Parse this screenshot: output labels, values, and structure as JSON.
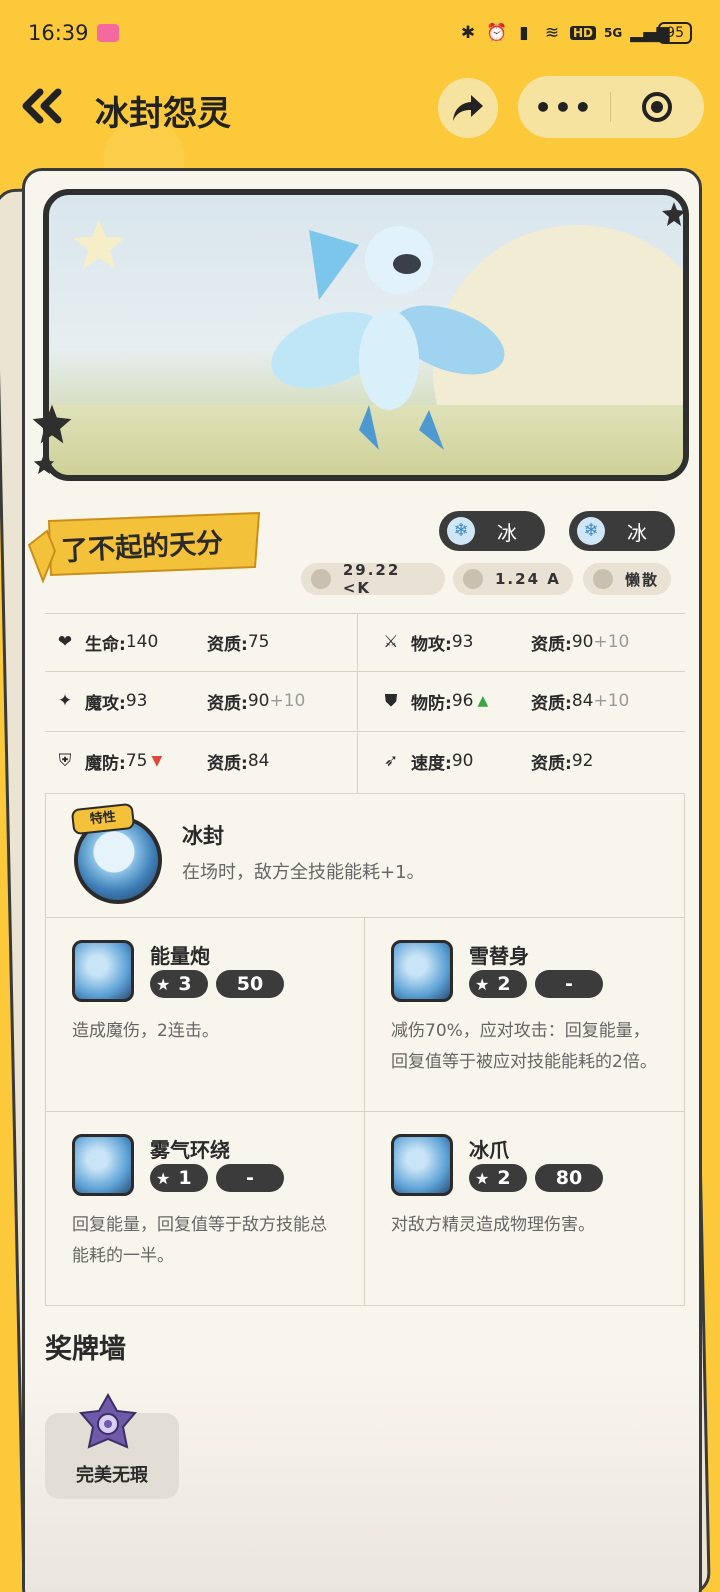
{
  "status_bar": {
    "time": "16:39",
    "app_badge": "дд",
    "network": "5G",
    "hd": "HD",
    "battery": "95"
  },
  "header": {
    "title": "冰封怨灵",
    "icons": [
      "back-icon",
      "share-icon",
      "more-icon",
      "target-icon"
    ]
  },
  "talent": {
    "label": "了不起的天分"
  },
  "types": [
    {
      "label": "冰",
      "icon": "snowflake-icon"
    },
    {
      "label": "冰",
      "icon": "snowflake-icon"
    }
  ],
  "meta": {
    "weight": "29.22 <K",
    "height": "1.24 A",
    "nature": "懒散"
  },
  "stats": [
    {
      "icon": "heart-icon",
      "name": "生命:",
      "value": "140",
      "apt_name": "资质:",
      "apt_value": "75",
      "apt_bonus": ""
    },
    {
      "icon": "sword-icon",
      "name": "物攻:",
      "value": "93",
      "apt_name": "资质:",
      "apt_value": "90",
      "apt_bonus": "+10"
    },
    {
      "icon": "magic-icon",
      "name": "魔攻:",
      "value": "93",
      "apt_name": "资质:",
      "apt_value": "90",
      "apt_bonus": "+10"
    },
    {
      "icon": "shield-icon",
      "name": "物防:",
      "value": "96",
      "apt_name": "资质:",
      "apt_value": "84",
      "apt_bonus": "+10",
      "trend": "up"
    },
    {
      "icon": "magic-shield-icon",
      "name": "魔防:",
      "value": "75",
      "apt_name": "资质:",
      "apt_value": "84",
      "apt_bonus": "",
      "trend": "down"
    },
    {
      "icon": "speed-icon",
      "name": "速度:",
      "value": "90",
      "apt_name": "资质:",
      "apt_value": "92",
      "apt_bonus": ""
    }
  ],
  "trait": {
    "tag": "特性",
    "name": "冰封",
    "desc": "在场时，敌方全技能能耗+1。"
  },
  "skills": [
    {
      "name": "能量炮",
      "level": "3",
      "cost": "50",
      "desc": "造成魔伤，2连击。"
    },
    {
      "name": "雪替身",
      "level": "2",
      "cost": "-",
      "desc": "减伤70%，应对攻击：回复能量，回复值等于被应对技能能耗的2倍。"
    },
    {
      "name": "雾气环绕",
      "level": "1",
      "cost": "-",
      "desc": "回复能量，回复值等于敌方技能总能耗的一半。"
    },
    {
      "name": "冰爪",
      "level": "2",
      "cost": "80",
      "desc": "对敌方精灵造成物理伤害。"
    }
  ],
  "medals": {
    "title": "奖牌墙",
    "items": [
      {
        "label": "完美无瑕"
      }
    ]
  },
  "colors": {
    "background": "#fbc93a",
    "card": "#f8f5ec",
    "pill": "#3b3b3b",
    "accent_up": "#39a843",
    "accent_down": "#e0463b"
  }
}
